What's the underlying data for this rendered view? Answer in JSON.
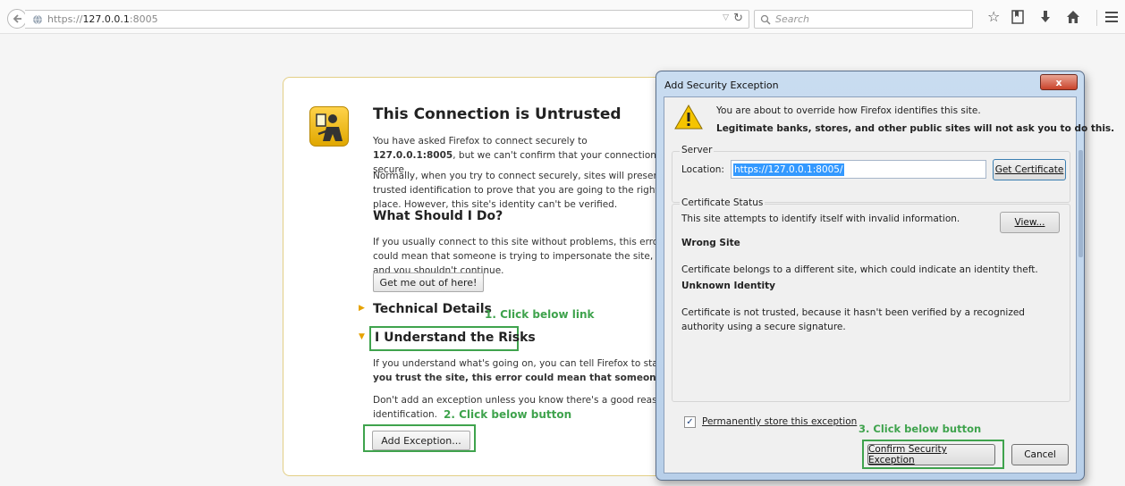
{
  "toolbar": {
    "url_prefix": "https://",
    "url_host": "127.0.0.1",
    "url_port": ":8005",
    "search_placeholder": "Search"
  },
  "error_page": {
    "title": "This Connection is Untrusted",
    "intro_text": "You have asked Firefox to connect securely to 127.0.0.1:8005, but we can't confirm that your connection is secure.",
    "normal_text": "Normally, when you try to connect securely, sites will present trusted identification to prove that you are going to the right place. However, this site's identity can't be verified.",
    "what_heading": "What Should I Do?",
    "what_text": "If you usually connect to this site without problems, this error could mean that someone is trying to impersonate the site, and you shouldn't continue.",
    "get_out_button": "Get me out of here!",
    "technical_details": "Technical Details",
    "understand_risks": "I Understand the Risks",
    "risks_text_1": "If you understand what's going on, you can tell Firefox to start trusting this site's identification.",
    "risks_text_2": "you trust the site, this error could mean that someone is tampering with your connection.",
    "dont_add_text": "Don't add an exception unless you know there's a good reason why this site doesn't use trusted",
    "identification_text": "identification.",
    "add_exception_button": "Add Exception..."
  },
  "annotations": {
    "step1": "1. Click below link",
    "step2": "2. Click below button",
    "step3": "3. Click below button"
  },
  "dialog": {
    "title": "Add Security Exception",
    "close_label": "x",
    "warning_line1": "You are about to override how Firefox identifies this site.",
    "warning_line2": "Legitimate banks, stores, and other public sites will not ask you to do this.",
    "server_label": "Server",
    "location_label": "Location:",
    "location_value": "https://127.0.0.1:8005/",
    "get_certificate_button": "Get Certificate",
    "cert_status_label": "Certificate Status",
    "status_intro": "This site attempts to identify itself with invalid information.",
    "view_button": "View...",
    "wrong_site_heading": "Wrong Site",
    "wrong_site_text": "Certificate belongs to a different site, which could indicate an identity theft.",
    "unknown_identity_heading": "Unknown Identity",
    "unknown_identity_text": "Certificate is not trusted, because it hasn't been verified by a recognized authority using a secure signature.",
    "permanent_store_label": "Permanently store this exception",
    "permanent_store_checked": true,
    "confirm_button": "Confirm Security Exception",
    "cancel_button": "Cancel"
  }
}
